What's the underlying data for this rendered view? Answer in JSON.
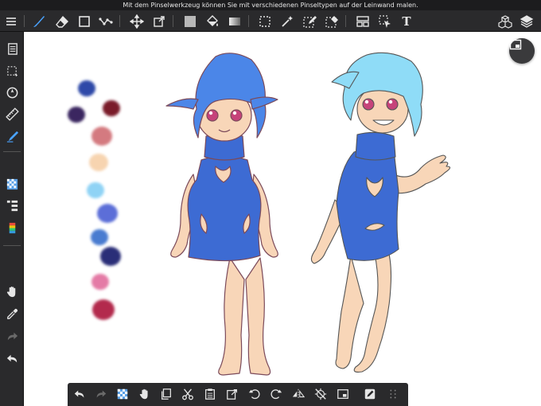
{
  "hint": "Mit dem Pinselwerkzeug können Sie mit verschiedenen Pinseltypen auf der Leinwand malen.",
  "colors": {
    "accent": "#4aa3ff",
    "toolbar_bg": "#2a2a2c",
    "canvas_bg": "#ffffff"
  },
  "toolbar": {
    "left_icons": [
      "menu-icon",
      "brush-icon",
      "eraser-icon",
      "rectangle-icon",
      "vector-icon",
      "move-icon",
      "transform-icon",
      "fill-color-icon",
      "bucket-icon",
      "gradient-icon",
      "select-rect-icon",
      "magic-wand-icon",
      "select-pen-icon",
      "select-eraser-icon",
      "layer-view-icon",
      "select-layer-icon",
      "text-icon"
    ],
    "right_icons": [
      "materials-icon",
      "layers-icon"
    ],
    "text_tool_label": "T"
  },
  "sidebar": {
    "icons": [
      "page-manager-icon",
      "selection-icon",
      "navigator-icon",
      "ruler-icon",
      "pen-settings-icon",
      "material-icon",
      "layer-list-icon",
      "color-palette-icon",
      "hand-icon",
      "eyedropper-icon",
      "redo-icon",
      "undo-icon"
    ]
  },
  "palette": [
    "#2f4aa8",
    "#7a1a2c",
    "#3a2560",
    "#d47a80",
    "#f7d4b0",
    "#8fd3f5",
    "#5b6ed8",
    "#4a7cd0",
    "#2c2f78",
    "#e47aa6",
    "#b3294e"
  ],
  "bottombar": {
    "icons": [
      "undo-icon",
      "redo-icon",
      "transparent-icon",
      "hand-icon",
      "copy-icon",
      "cut-icon",
      "paste-icon",
      "import-icon",
      "rotate-left-icon",
      "rotate-right-icon",
      "flip-icon",
      "snap-off-icon",
      "fit-screen-icon",
      "edit-icon",
      "grid-icon"
    ]
  }
}
